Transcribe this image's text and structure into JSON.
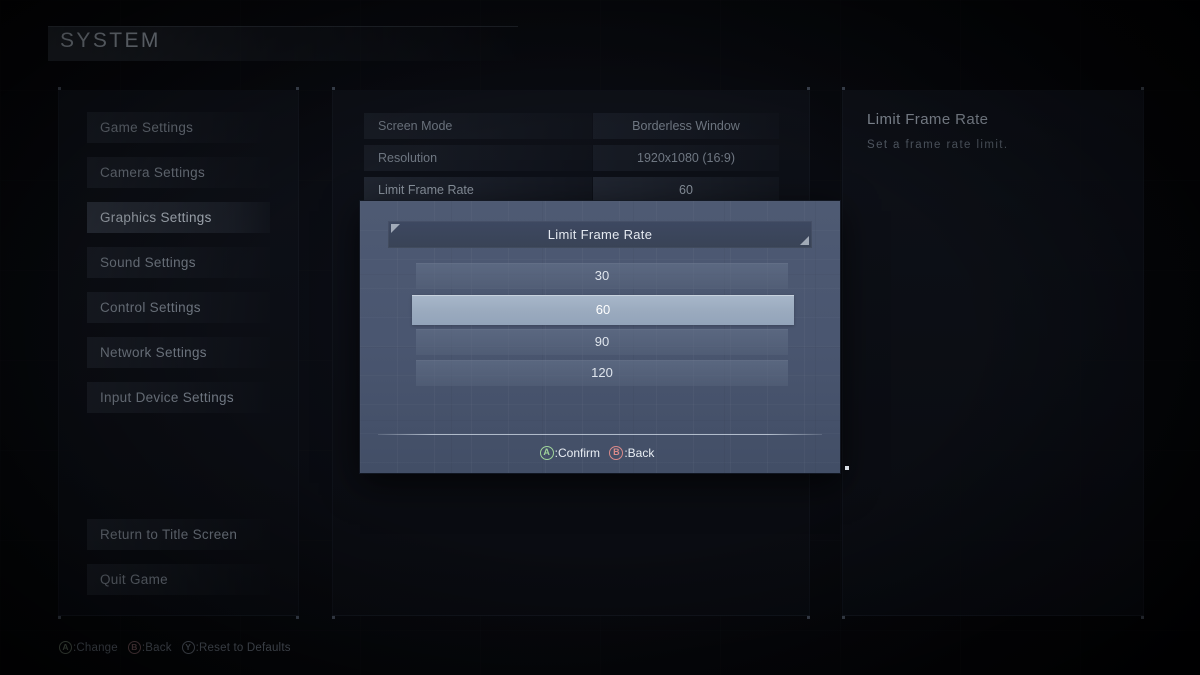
{
  "header": {
    "title": "SYSTEM"
  },
  "sidebar": {
    "items": [
      {
        "label": "Game Settings",
        "selected": false
      },
      {
        "label": "Camera Settings",
        "selected": false
      },
      {
        "label": "Graphics Settings",
        "selected": true
      },
      {
        "label": "Sound Settings",
        "selected": false
      },
      {
        "label": "Control Settings",
        "selected": false
      },
      {
        "label": "Network Settings",
        "selected": false
      },
      {
        "label": "Input Device Settings",
        "selected": false
      }
    ],
    "bottom_items": [
      {
        "label": "Return to Title Screen"
      },
      {
        "label": "Quit Game"
      }
    ]
  },
  "settings": {
    "rows": [
      {
        "label": "Screen Mode",
        "value": "Borderless Window",
        "active": false
      },
      {
        "label": "Resolution",
        "value": "1920x1080 (16:9)",
        "active": false
      },
      {
        "label": "Limit Frame Rate",
        "value": "60",
        "active": true
      }
    ]
  },
  "info": {
    "title": "Limit Frame Rate",
    "description": "Set a frame rate limit."
  },
  "modal": {
    "title": "Limit Frame Rate",
    "options": [
      {
        "label": "30",
        "selected": false
      },
      {
        "label": "60",
        "selected": true
      },
      {
        "label": "90",
        "selected": false
      },
      {
        "label": "120",
        "selected": false
      }
    ],
    "hints": [
      {
        "button": "A",
        "label": ":Confirm",
        "color": "#9fd39a"
      },
      {
        "button": "B",
        "label": ":Back",
        "color": "#d98a8a"
      }
    ]
  },
  "footer": {
    "hints": [
      {
        "button": "A",
        "label": ":Change",
        "color": "#5e6b5d"
      },
      {
        "button": "B",
        "label": ":Back",
        "color": "#6d5256"
      },
      {
        "button": "Y",
        "label": ":Reset to Defaults",
        "color": "#5b636e"
      }
    ]
  },
  "colors": {
    "modal_body": "#4a5670",
    "modal_header": "#3d4861",
    "option_selected": "#9aaabe",
    "option_normal": "#68768e",
    "accent_text": "#e4e9f0"
  }
}
